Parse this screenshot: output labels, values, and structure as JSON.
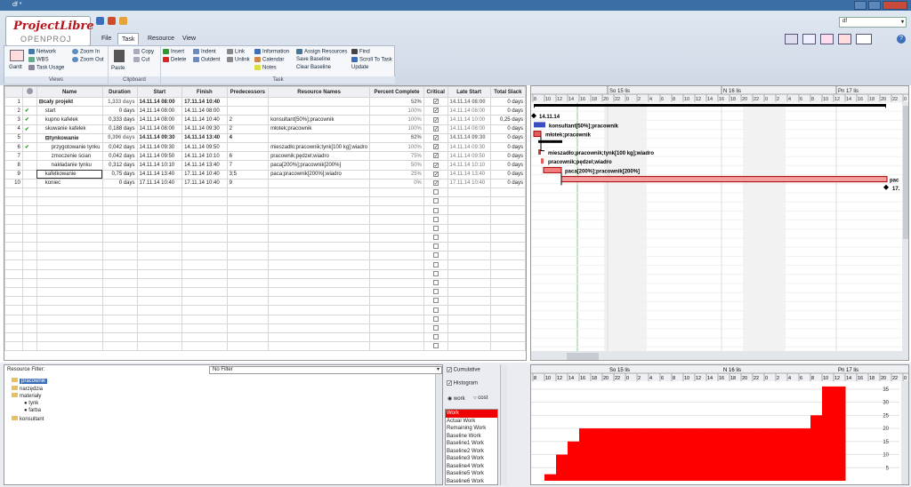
{
  "window": {
    "title": "df *"
  },
  "app": {
    "brand": "ProjectLibre",
    "brand_sub": "OPENPROJ"
  },
  "tabs": [
    "File",
    "Task",
    "Resource",
    "View"
  ],
  "active_tab": "Task",
  "project_select": "df",
  "ribbon": {
    "views": {
      "label": "Views",
      "gantt": "Gantt",
      "network": "Network",
      "wbs": "WBS",
      "task_usage": "Task Usage",
      "zoom_in": "Zoom In",
      "zoom_out": "Zoom Out"
    },
    "clipboard": {
      "label": "Clipboard",
      "paste": "Paste",
      "copy": "Copy",
      "cut": "Cut"
    },
    "task": {
      "label": "Task",
      "insert": "Insert",
      "delete": "Delete",
      "indent": "Indent",
      "outdent": "Outdent",
      "link": "Link",
      "unlink": "Unlink",
      "information": "Information",
      "calendar": "Calendar",
      "notes": "Notes",
      "assign_resources": "Assign Resources",
      "save_baseline": "Save Baseline",
      "clear_baseline": "Clear Baseline",
      "find": "Find",
      "scroll_to_task": "Scroll To Task",
      "update": "Update"
    }
  },
  "grid": {
    "columns": [
      "",
      "",
      "Name",
      "Duration",
      "Start",
      "Finish",
      "Predecessors",
      "Resource Names",
      "Percent Complete",
      "Critical",
      "Late Start",
      "Total Slack"
    ],
    "rows": [
      {
        "id": "1",
        "ind": "",
        "name": "cały projekt",
        "dur": "1,333 days",
        "start": "14.11.14 08:00",
        "finish": "17.11.14 10:40",
        "pred": "",
        "res": "",
        "pct": "52%",
        "crit": true,
        "late": "14.11.14 08:00",
        "slack": "0 days",
        "summary": true,
        "level": 0
      },
      {
        "id": "2",
        "ind": "✔",
        "name": "start",
        "dur": "0 days",
        "start": "14.11.14 08:00",
        "finish": "14.11.14 08:00",
        "pred": "",
        "res": "",
        "pct": "100%",
        "crit": true,
        "late": "14.11.14 08:00",
        "slack": "0 days",
        "summary": false,
        "level": 1
      },
      {
        "id": "3",
        "ind": "✔",
        "name": "kupno kafelek",
        "dur": "0,333 days",
        "start": "14.11.14 08:00",
        "finish": "14.11.14 10:40",
        "pred": "2",
        "res": "konsultant[50%];pracownik",
        "pct": "100%",
        "crit": true,
        "late": "14.11.14 10:00",
        "slack": "0,25 days",
        "summary": false,
        "level": 1
      },
      {
        "id": "4",
        "ind": "✔",
        "name": "skuwanie kafelek",
        "dur": "0,188 days",
        "start": "14.11.14 08:00",
        "finish": "14.11.14 09:30",
        "pred": "2",
        "res": "młotek;pracownik",
        "pct": "100%",
        "crit": true,
        "late": "14.11.14 08:00",
        "slack": "0 days",
        "summary": false,
        "level": 1
      },
      {
        "id": "5",
        "ind": "",
        "name": "tynkowanie",
        "dur": "0,396 days",
        "start": "14.11.14 09:30",
        "finish": "14.11.14 13:40",
        "pred": "4",
        "res": "",
        "pct": "62%",
        "crit": true,
        "late": "14.11.14 09:30",
        "slack": "0 days",
        "summary": true,
        "level": 1
      },
      {
        "id": "6",
        "ind": "✔",
        "name": "przygotowanie tynku",
        "dur": "0,042 days",
        "start": "14.11.14 09:30",
        "finish": "14.11.14 09:50",
        "pred": "",
        "res": "mieszadło;pracownik;tynk[100 kg];wiadro",
        "pct": "100%",
        "crit": true,
        "late": "14.11.14 09:30",
        "slack": "0 days",
        "summary": false,
        "level": 2
      },
      {
        "id": "7",
        "ind": "",
        "name": "zmoczenie ścian",
        "dur": "0,042 days",
        "start": "14.11.14 09:50",
        "finish": "14.11.14 10:10",
        "pred": "6",
        "res": "pracownik;pędzel;wiadro",
        "pct": "75%",
        "crit": true,
        "late": "14.11.14 09:50",
        "slack": "0 days",
        "summary": false,
        "level": 2
      },
      {
        "id": "8",
        "ind": "",
        "name": "nakładanie tynku",
        "dur": "0,312 days",
        "start": "14.11.14 10:10",
        "finish": "14.11.14 13:40",
        "pred": "7",
        "res": "paca[200%];pracownik[200%]",
        "pct": "50%",
        "crit": true,
        "late": "14.11.14 10:10",
        "slack": "0 days",
        "summary": false,
        "level": 2
      },
      {
        "id": "9",
        "ind": "",
        "name": "kafelkowanie",
        "dur": "0,75 days",
        "start": "14.11.14 13:40",
        "finish": "17.11.14 10:40",
        "pred": "3;5",
        "res": "paca;pracownik[200%];wiadro",
        "pct": "25%",
        "crit": true,
        "late": "14.11.14 13:40",
        "slack": "0 days",
        "summary": false,
        "level": 1
      },
      {
        "id": "10",
        "ind": "",
        "name": "koniec",
        "dur": "0 days",
        "start": "17.11.14 10:40",
        "finish": "17.11.14 10:40",
        "pred": "9",
        "res": "",
        "pct": "0%",
        "crit": true,
        "late": "17.11.14 10:40",
        "slack": "0 days",
        "summary": false,
        "level": 1
      }
    ],
    "empty_rows": 18
  },
  "gantt": {
    "days": [
      "So 15 lis",
      "N 16 lis",
      "Pn 17 lis"
    ],
    "hours": [
      "8",
      "10",
      "12",
      "14",
      "16",
      "18",
      "20",
      "22",
      "0",
      "2",
      "4",
      "6",
      "8",
      "10",
      "12",
      "14",
      "16",
      "18",
      "20",
      "22",
      "0",
      "2",
      "4",
      "6",
      "8",
      "10",
      "12",
      "14",
      "16",
      "18",
      "20",
      "22",
      "0",
      "2",
      "4",
      "6",
      "8",
      "10",
      "12"
    ],
    "labels": {
      "milestone_start": "14.11.14",
      "task3": "konsultant[50%];pracownik",
      "task4": "młotek;pracownik",
      "task6": "mieszadło;pracownik;tynk[100 kg];wiadro",
      "task7": "pracownik;pędzel;wiadro",
      "task8": "paca[200%];pracownik[200%]",
      "task9": "pac",
      "task10": "17."
    }
  },
  "resources": {
    "filter_label": "Resource Filter:",
    "filter_value": "No Filter",
    "tree": [
      {
        "name": "pracownik",
        "level": 1,
        "selected": true
      },
      {
        "name": "narzędzia",
        "level": 1,
        "selected": false
      },
      {
        "name": "materiały",
        "level": 1,
        "selected": false
      },
      {
        "name": "tynk",
        "level": 2,
        "selected": false
      },
      {
        "name": "farba",
        "level": 2,
        "selected": false
      },
      {
        "name": "konsultant",
        "level": 1,
        "selected": false
      }
    ]
  },
  "histogram_options": {
    "cumulative": "Cumulative",
    "histogram": "Histogram",
    "work": "work",
    "cost": "cost",
    "list": [
      "Work",
      "Actual Work",
      "Remaining Work",
      "Baseline Work",
      "Baseline1 Work",
      "Baseline2 Work",
      "Baseline3 Work",
      "Baseline4 Work",
      "Baseline5 Work",
      "Baseline6 Work"
    ],
    "selected": "Work"
  },
  "chart_data": {
    "type": "area",
    "title": "",
    "ylabel": "",
    "y_ticks": [
      5,
      10,
      15,
      20,
      25,
      30,
      35
    ],
    "ylim": [
      0,
      38
    ],
    "x_hours": [
      8,
      10,
      12,
      14,
      16,
      18,
      20,
      22,
      0,
      2,
      4,
      6,
      8,
      10,
      12,
      14,
      16,
      18,
      20,
      22,
      0,
      2,
      4,
      6,
      8,
      10,
      12
    ],
    "series": [
      {
        "values": [
          0,
          2.5,
          10,
          15,
          20,
          20,
          20,
          20,
          20,
          20,
          20,
          20,
          20,
          20,
          20,
          20,
          20,
          20,
          20,
          20,
          20,
          20,
          20,
          20,
          25,
          36,
          36
        ]
      }
    ],
    "colors": {
      "fill": "#ff0000"
    }
  }
}
